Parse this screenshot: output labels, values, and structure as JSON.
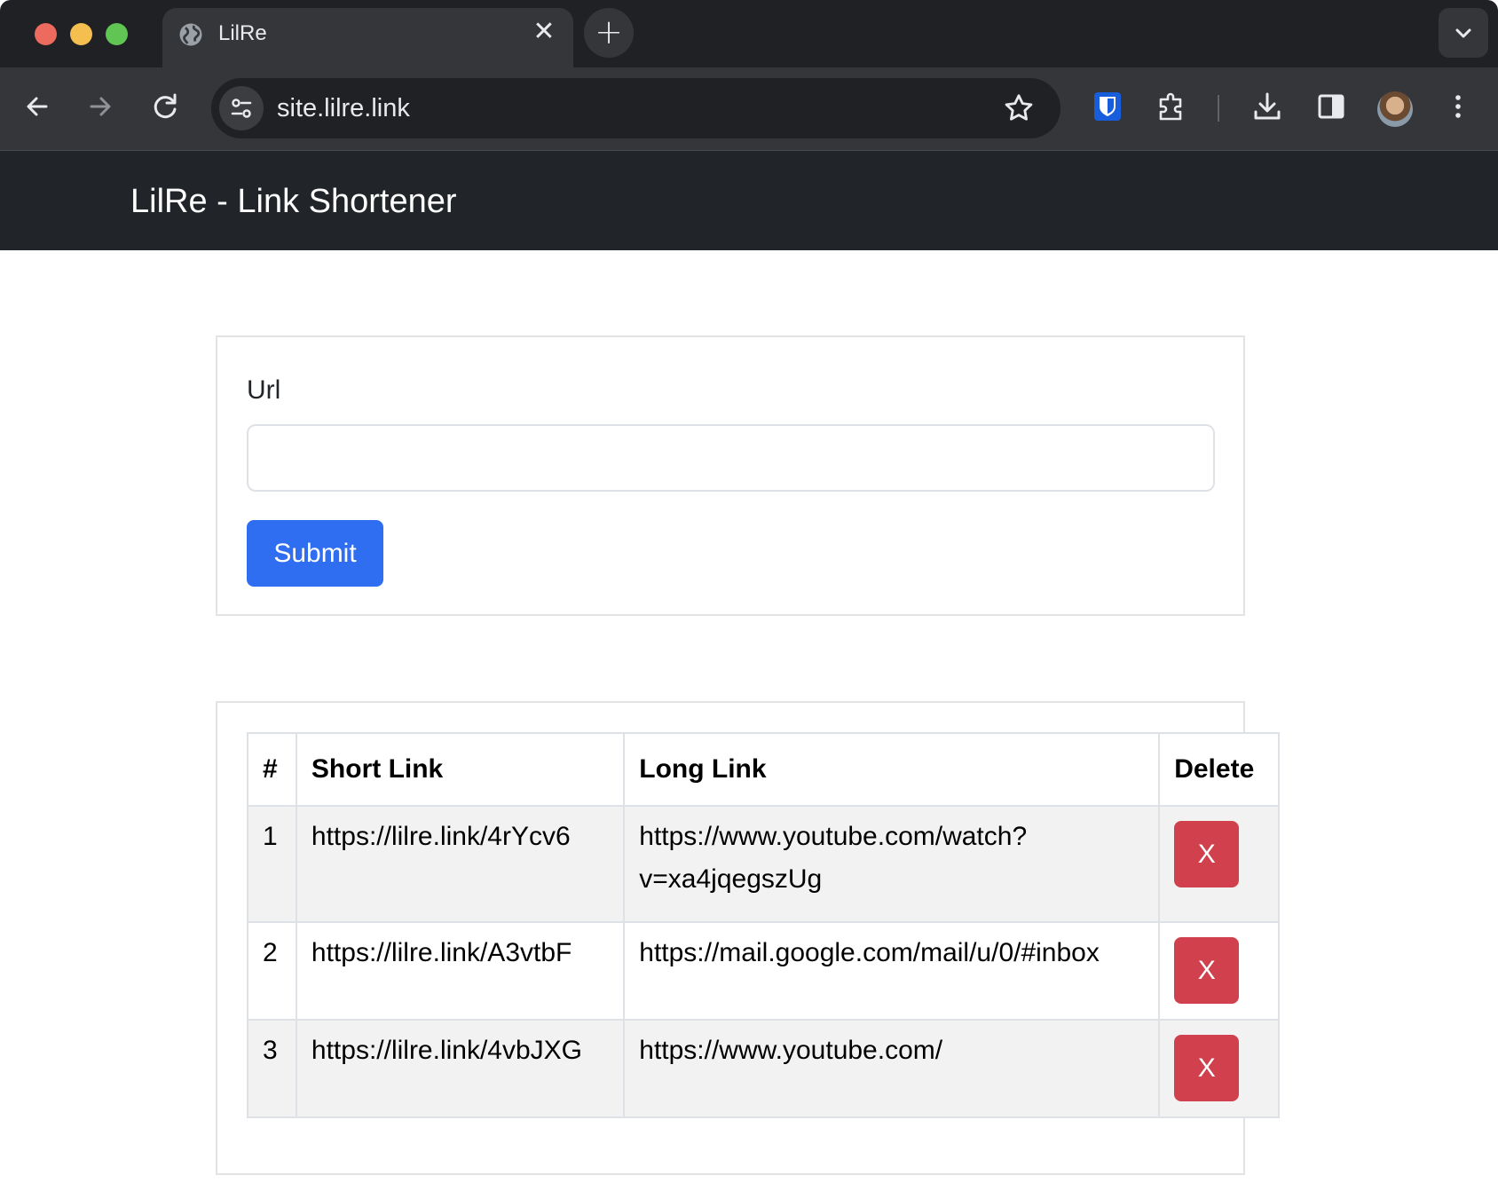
{
  "browser": {
    "tab_title": "LilRe",
    "tab_close": "✕",
    "new_tab": "+",
    "url": "site.lilre.link"
  },
  "navbar": {
    "brand": "LilRe - Link Shortener"
  },
  "form": {
    "label": "Url",
    "input_value": "",
    "submit_label": "Submit"
  },
  "table": {
    "headers": {
      "num": "#",
      "short": "Short Link",
      "long": "Long Link",
      "delete": "Delete"
    },
    "rows": [
      {
        "num": "1",
        "short": "https://lilre.link/4rYcv6",
        "long": "https://www.youtube.com/watch?v=xa4jqegszUg",
        "delete": "X"
      },
      {
        "num": "2",
        "short": "https://lilre.link/A3vtbF",
        "long": "https://mail.google.com/mail/u/0/#inbox",
        "delete": "X"
      },
      {
        "num": "3",
        "short": "https://lilre.link/4vbJXG",
        "long": "https://www.youtube.com/",
        "delete": "X"
      }
    ]
  },
  "colors": {
    "navbar_bg": "#212529",
    "submit_bg": "#2f6ef0",
    "delete_bg": "#d0414d",
    "chrome_tabstrip": "#202124",
    "chrome_toolbar": "#35363a"
  },
  "icons": [
    "globe-icon",
    "close-icon",
    "plus-icon",
    "chevron-down-icon",
    "back-arrow-icon",
    "forward-arrow-icon",
    "reload-icon",
    "site-settings-icon",
    "star-icon",
    "bitwarden-icon",
    "extensions-icon",
    "download-icon",
    "side-panel-icon",
    "profile-avatar",
    "kebab-menu-icon"
  ]
}
